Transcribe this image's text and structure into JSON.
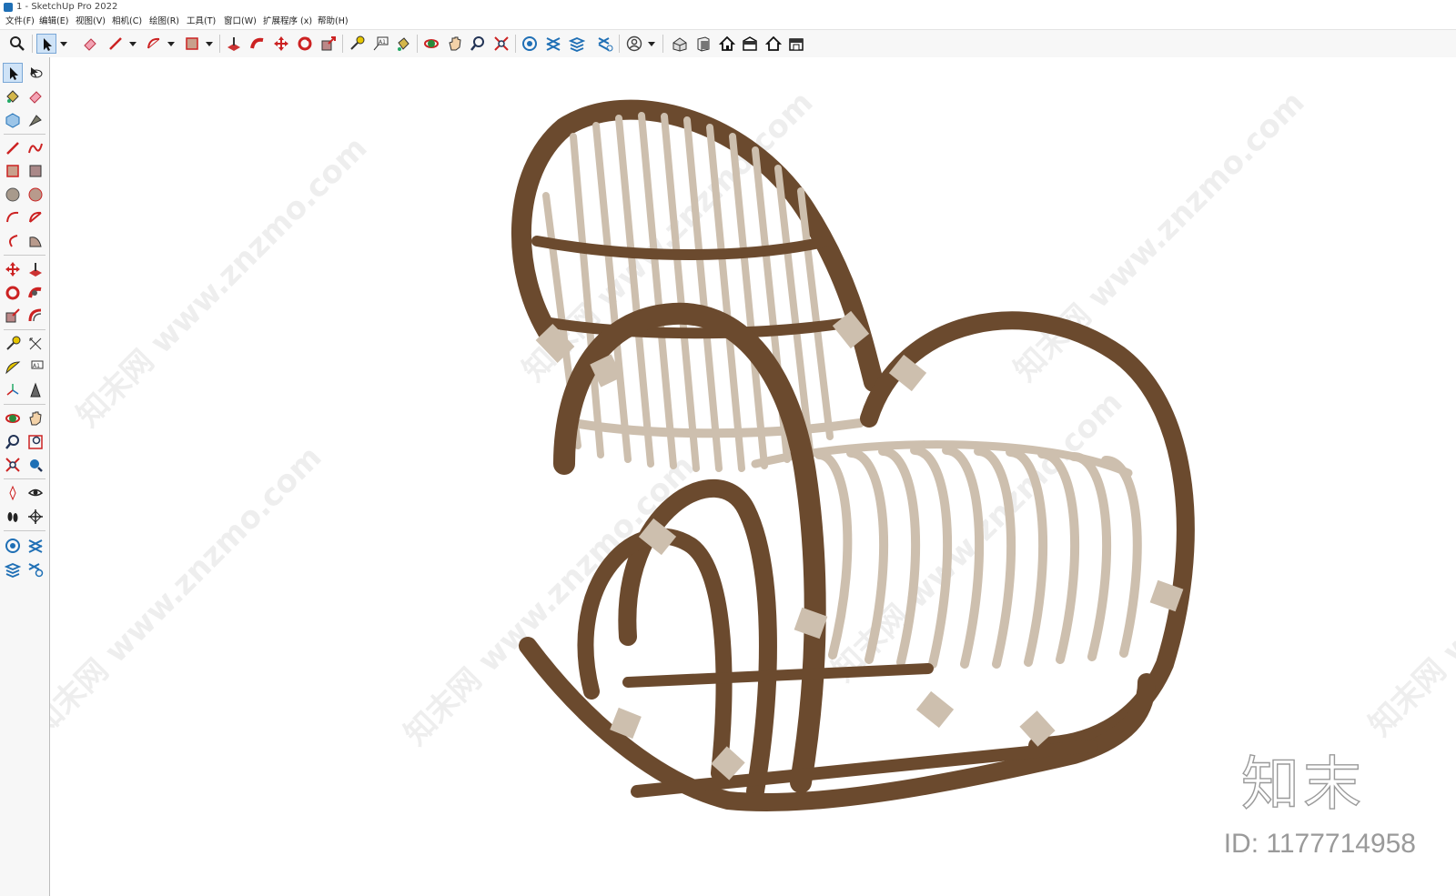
{
  "window": {
    "title": "1 - SketchUp Pro 2022"
  },
  "menu": [
    {
      "label": "文件(F)"
    },
    {
      "label": "编辑(E)"
    },
    {
      "label": "视图(V)"
    },
    {
      "label": "相机(C)"
    },
    {
      "label": "绘图(R)"
    },
    {
      "label": "工具(T)"
    },
    {
      "label": "窗口(W)"
    },
    {
      "label": "扩展程序 (x)"
    },
    {
      "label": "帮助(H)"
    }
  ],
  "toolbar_icons": [
    "zoom-icon",
    "select-icon",
    "eraser-icon",
    "pencil-line-icon",
    "arc-icon",
    "rectangle-icon",
    "push-pull-icon",
    "follow-me-icon",
    "move-icon",
    "rotate-icon",
    "scale-icon",
    "tape-measure-icon",
    "text-icon",
    "paint-bucket-icon",
    "orbit-icon",
    "pan-icon",
    "zoom-window-icon",
    "zoom-extents-icon",
    "sandbox-icon",
    "xray-icon",
    "layers-icon",
    "section-icon",
    "user-icon",
    "iso-view-icon",
    "front-view-icon",
    "top-view-icon",
    "right-view-icon",
    "back-view-icon",
    "left-view-icon"
  ],
  "sidebar_icons": [
    "select-icon",
    "orbit-icon",
    "paint-bucket-icon",
    "eraser-icon",
    "component-icon",
    "tag-icon",
    "line-icon",
    "freehand-icon",
    "rectangle-icon",
    "rotated-rectangle-icon",
    "circle-icon",
    "polygon-icon",
    "arc-icon",
    "pie-icon",
    "arc3-icon",
    "sector-icon",
    "move-icon",
    "push-pull-icon",
    "rotate-icon",
    "follow-me-icon",
    "scale-icon",
    "offset-icon",
    "tape-measure-icon",
    "dimension-icon",
    "protractor-icon",
    "text-icon",
    "axes-icon",
    "3d-text-icon",
    "orbit2-icon",
    "pan-icon",
    "zoom-icon",
    "zoom-window-icon",
    "zoom-extents-icon",
    "previous-icon",
    "position-camera-icon",
    "look-around-icon",
    "walk-icon",
    "section-plane-icon",
    "sandbox-icon",
    "xray-icon",
    "layers-icon",
    "settings-icon"
  ],
  "watermark": {
    "text": "知末网 www.znzmo.com"
  },
  "brand": {
    "logo": "知末",
    "id": "ID: 1177714958"
  },
  "colors": {
    "rattan_dark": "#6b4a2e",
    "rattan_light": "#cdbfae",
    "accent": "#cfe3f7"
  }
}
